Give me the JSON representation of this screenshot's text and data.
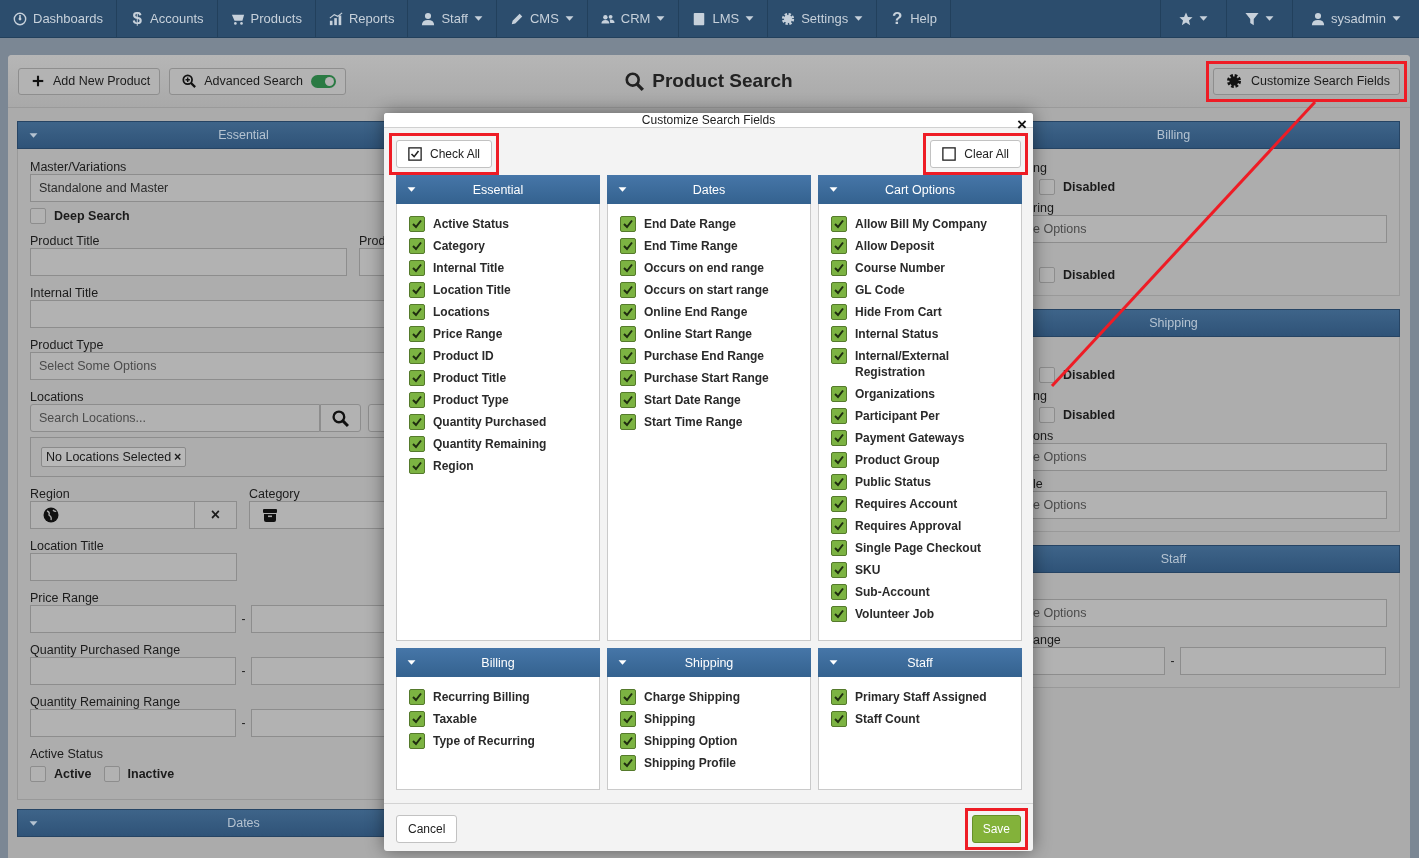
{
  "nav": {
    "items": [
      {
        "label": "Dashboards",
        "dropdown": false
      },
      {
        "label": "Accounts",
        "glyph": "$",
        "dropdown": false
      },
      {
        "label": "Products",
        "dropdown": false
      },
      {
        "label": "Reports",
        "dropdown": false
      },
      {
        "label": "Staff",
        "dropdown": true
      },
      {
        "label": "CMS",
        "dropdown": true
      },
      {
        "label": "CRM",
        "dropdown": true
      },
      {
        "label": "LMS",
        "dropdown": true
      },
      {
        "label": "Settings",
        "dropdown": true
      },
      {
        "label": "Help",
        "glyph": "?",
        "dropdown": false
      }
    ],
    "right_items": [
      {
        "dropdown": true
      },
      {
        "dropdown": true
      },
      {
        "label": "sysadmin",
        "dropdown": true
      }
    ]
  },
  "toolbar": {
    "buttons": [
      {
        "label": "Add New Product"
      },
      {
        "label": "Advanced Search",
        "toggle_on": true
      }
    ],
    "title": "Product Search",
    "customize_button": {
      "label": "Customize Search Fields",
      "highlighted": true
    }
  },
  "left_column": {
    "sections": [
      {
        "title": "Essential",
        "fields": [
          {
            "kind": "select",
            "label": "Master/Variations",
            "value": "Standalone and Master"
          },
          {
            "kind": "checkbox",
            "label": "Deep Search",
            "checked": false
          },
          {
            "kind": "text-split",
            "label": "Product Title",
            "label_2": "Prod"
          },
          {
            "kind": "text",
            "label": "Internal Title"
          },
          {
            "kind": "multiselect",
            "label": "Product Type",
            "placeholder": "Select Some Options"
          },
          {
            "kind": "search",
            "label": "Locations",
            "placeholder": "Search Locations...",
            "tag": "No Locations Selected",
            "tag_remove": "×"
          },
          {
            "kind": "icon-pair",
            "label": "Region",
            "label_2": "Category",
            "clear": "×"
          },
          {
            "kind": "text-short",
            "label": "Location Title"
          },
          {
            "kind": "range",
            "label": "Price Range",
            "separator": "-"
          },
          {
            "kind": "range",
            "label": "Quantity Purchased Range",
            "separator": "-"
          },
          {
            "kind": "range",
            "label": "Quantity Remaining Range",
            "separator": "-"
          },
          {
            "kind": "checks",
            "label": "Active Status",
            "options": [
              {
                "label": "Active",
                "checked": false
              },
              {
                "label": "Inactive",
                "checked": false
              }
            ]
          }
        ]
      },
      {
        "title": "Dates"
      }
    ]
  },
  "right_column": {
    "sections": [
      {
        "title": "Billing",
        "items": [
          {
            "kind": "label",
            "text": "ng"
          },
          {
            "kind": "checkbox",
            "label": "Disabled",
            "checked": false
          },
          {
            "kind": "label",
            "text": "ring"
          },
          {
            "kind": "select",
            "placeholder": "e Options"
          },
          {
            "kind": "checkbox",
            "label": "Disabled",
            "checked": false
          }
        ]
      },
      {
        "title": "Shipping",
        "items": [
          {
            "kind": "checkbox",
            "label": "Disabled",
            "checked": false
          },
          {
            "kind": "label",
            "text": "ng"
          },
          {
            "kind": "checkbox",
            "label": "Disabled",
            "checked": false
          },
          {
            "kind": "label",
            "text": "ons"
          },
          {
            "kind": "select",
            "placeholder": "e Options"
          },
          {
            "kind": "label",
            "text": "le"
          },
          {
            "kind": "select",
            "placeholder": "e Options"
          }
        ]
      },
      {
        "title": "Staff",
        "items": [
          {
            "kind": "select",
            "placeholder": "e Options"
          },
          {
            "kind": "label",
            "text": "ange"
          },
          {
            "kind": "range",
            "separator": "-"
          }
        ]
      }
    ]
  },
  "modal": {
    "title": "Customize Search Fields",
    "close": "×",
    "check_all": {
      "label": "Check All",
      "highlighted": true
    },
    "clear_all": {
      "label": "Clear All",
      "highlighted": true
    },
    "groups": [
      {
        "title": "Essential",
        "fields": [
          {
            "label": "Active Status",
            "checked": true
          },
          {
            "label": "Category",
            "checked": true
          },
          {
            "label": "Internal Title",
            "checked": true
          },
          {
            "label": "Location Title",
            "checked": true
          },
          {
            "label": "Locations",
            "checked": true
          },
          {
            "label": "Price Range",
            "checked": true
          },
          {
            "label": "Product ID",
            "checked": true
          },
          {
            "label": "Product Title",
            "checked": true
          },
          {
            "label": "Product Type",
            "checked": true
          },
          {
            "label": "Quantity Purchased",
            "checked": true
          },
          {
            "label": "Quantity Remaining",
            "checked": true
          },
          {
            "label": "Region",
            "checked": true
          }
        ]
      },
      {
        "title": "Dates",
        "fields": [
          {
            "label": "End Date Range",
            "checked": true
          },
          {
            "label": "End Time Range",
            "checked": true
          },
          {
            "label": "Occurs on end range",
            "checked": true
          },
          {
            "label": "Occurs on start range",
            "checked": true
          },
          {
            "label": "Online End Range",
            "checked": true
          },
          {
            "label": "Online Start Range",
            "checked": true
          },
          {
            "label": "Purchase End Range",
            "checked": true
          },
          {
            "label": "Purchase Start Range",
            "checked": true
          },
          {
            "label": "Start Date Range",
            "checked": true
          },
          {
            "label": "Start Time Range",
            "checked": true
          }
        ]
      },
      {
        "title": "Cart Options",
        "fields": [
          {
            "label": "Allow Bill My Company",
            "checked": true
          },
          {
            "label": "Allow Deposit",
            "checked": true
          },
          {
            "label": "Course Number",
            "checked": true
          },
          {
            "label": "GL Code",
            "checked": true
          },
          {
            "label": "Hide From Cart",
            "checked": true
          },
          {
            "label": "Internal Status",
            "checked": true
          },
          {
            "label": "Internal/External Registration",
            "checked": true
          },
          {
            "label": "Organizations",
            "checked": true
          },
          {
            "label": "Participant Per",
            "checked": true
          },
          {
            "label": "Payment Gateways",
            "checked": true
          },
          {
            "label": "Product Group",
            "checked": true
          },
          {
            "label": "Public Status",
            "checked": true
          },
          {
            "label": "Requires Account",
            "checked": true
          },
          {
            "label": "Requires Approval",
            "checked": true
          },
          {
            "label": "Single Page Checkout",
            "checked": true
          },
          {
            "label": "SKU",
            "checked": true
          },
          {
            "label": "Sub-Account",
            "checked": true
          },
          {
            "label": "Volunteer Job",
            "checked": true
          }
        ]
      },
      {
        "title": "Billing",
        "fields": [
          {
            "label": "Recurring Billing",
            "checked": true
          },
          {
            "label": "Taxable",
            "checked": true
          },
          {
            "label": "Type of Recurring",
            "checked": true
          }
        ]
      },
      {
        "title": "Shipping",
        "fields": [
          {
            "label": "Charge Shipping",
            "checked": true
          },
          {
            "label": "Shipping",
            "checked": true
          },
          {
            "label": "Shipping Option",
            "checked": true
          },
          {
            "label": "Shipping Profile",
            "checked": true
          }
        ]
      },
      {
        "title": "Staff",
        "fields": [
          {
            "label": "Primary Staff Assigned",
            "checked": true
          },
          {
            "label": "Staff Count",
            "checked": true
          }
        ]
      }
    ],
    "cancel": {
      "label": "Cancel",
      "highlighted": false
    },
    "save": {
      "label": "Save",
      "highlighted": true
    }
  }
}
